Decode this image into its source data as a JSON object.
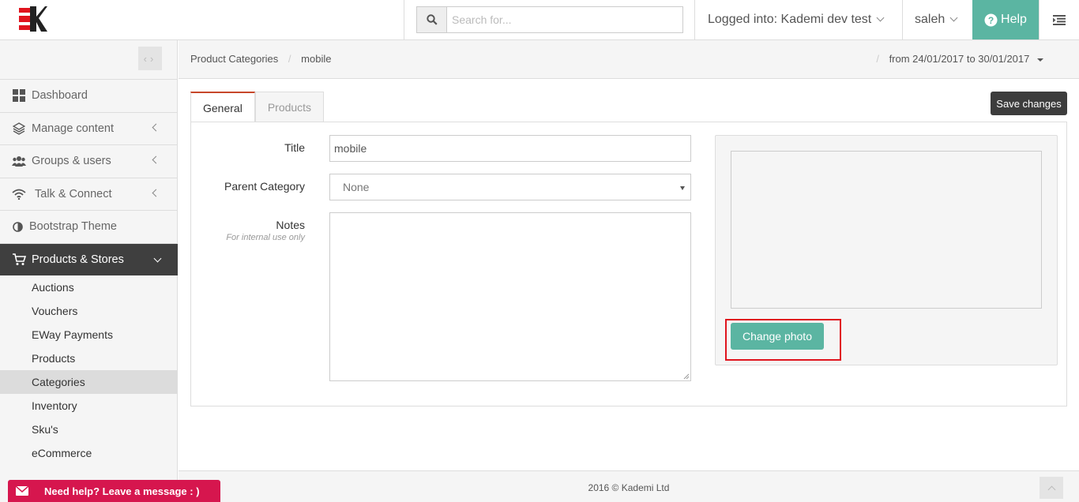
{
  "header": {
    "search_placeholder": "Search for...",
    "logged_into": "Logged into: Kademi dev test",
    "user": "saleh",
    "help": "Help"
  },
  "sidebar": {
    "items": [
      {
        "label": "Dashboard",
        "icon": "grid-icon"
      },
      {
        "label": "Manage content",
        "icon": "layers-icon"
      },
      {
        "label": "Groups & users",
        "icon": "users-icon"
      },
      {
        "label": "Talk & Connect",
        "icon": "wifi-icon"
      },
      {
        "label": "Bootstrap Theme",
        "icon": "contrast-icon"
      },
      {
        "label": "Products & Stores",
        "icon": "cart-icon"
      }
    ],
    "subitems": [
      "Auctions",
      "Vouchers",
      "EWay Payments",
      "Products",
      "Categories",
      "Inventory",
      "Sku's",
      "eCommerce"
    ]
  },
  "breadcrumb": {
    "parent": "Product Categories",
    "sep": "/",
    "current": "mobile"
  },
  "daterange": "from 24/01/2017 to 30/01/2017",
  "tabs": [
    "General",
    "Products"
  ],
  "save_label": "Save changes",
  "form": {
    "title_label": "Title",
    "title_value": "mobile",
    "parent_label": "Parent Category",
    "parent_value": "None",
    "notes_label": "Notes",
    "notes_hint": "For internal use only",
    "notes_value": ""
  },
  "photo_button": "Change photo",
  "footer": {
    "copyright": "2016 © Kademi Ltd"
  },
  "help_chat": "Need help? Leave a message : )",
  "colors": {
    "accent": "#5bb5a2",
    "dark": "#3f3f3f",
    "tab_border": "#c7472a",
    "highlight": "#e0141e",
    "chat": "#d6164e"
  }
}
